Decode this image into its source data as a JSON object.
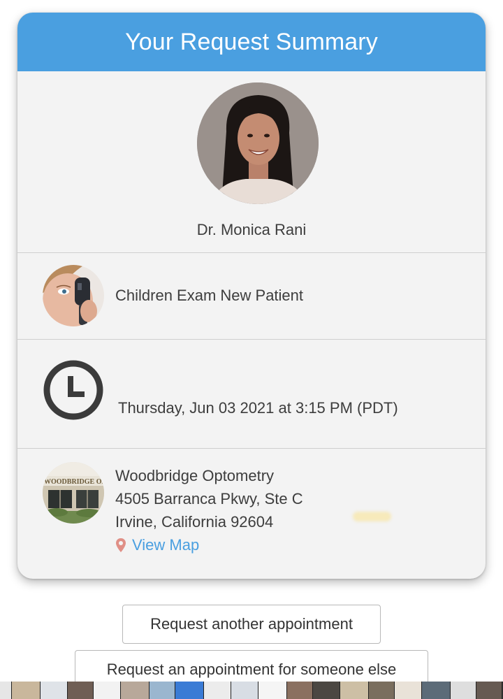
{
  "header": {
    "title": "Your Request Summary"
  },
  "provider": {
    "name": "Dr. Monica Rani"
  },
  "service": {
    "name": "Children Exam New Patient"
  },
  "appointment": {
    "datetime": "Thursday, Jun 03 2021 at 3:15 PM (PDT)"
  },
  "location": {
    "name": "Woodbridge Optometry",
    "address_line1": "4505 Barranca Pkwy, Ste C",
    "address_line2": "Irvine, California 92604",
    "view_map_label": "View Map",
    "sign_text": "WOODBRIDGE OPTOM"
  },
  "actions": {
    "request_another": "Request another appointment",
    "request_someone_else": "Request an appointment for someone else"
  },
  "colors": {
    "header_bg": "#4a9fe0",
    "link": "#4a9fe0",
    "pin": "#e08f86",
    "card_bg": "#f3f3f3"
  }
}
